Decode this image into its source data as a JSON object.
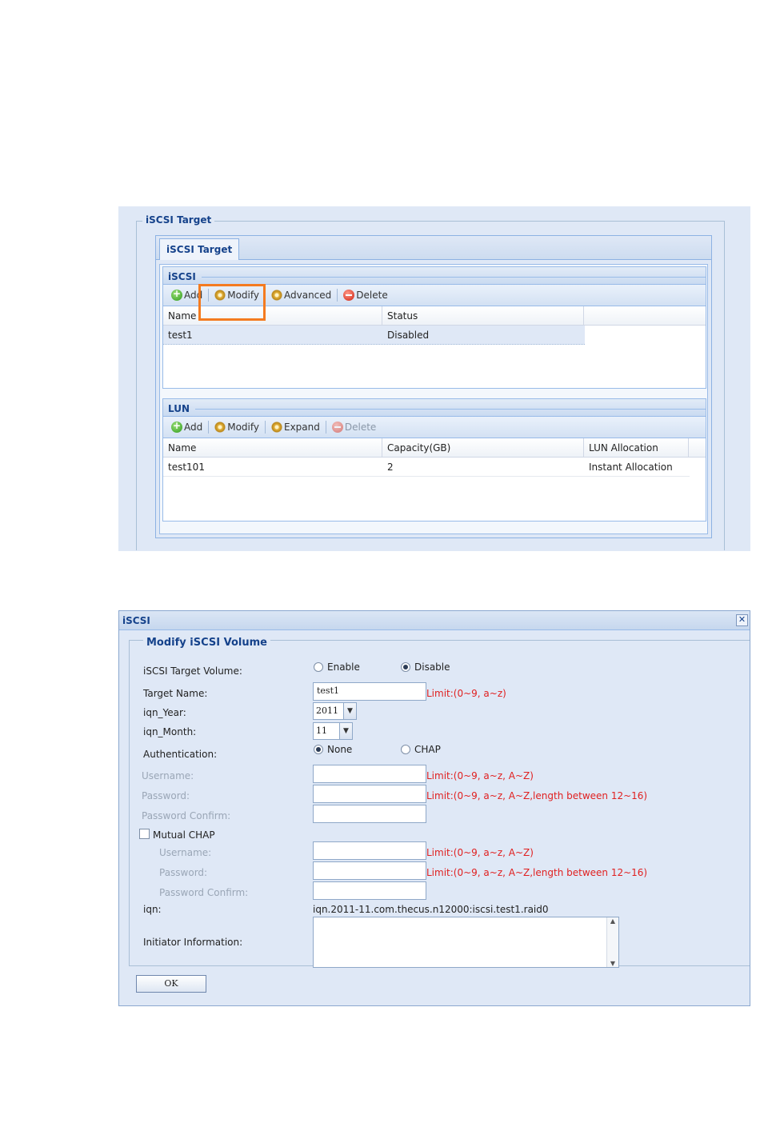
{
  "target_panel": {
    "fieldset_legend": "iSCSI Target",
    "tab_label": "iSCSI Target",
    "iscsi_section": {
      "title": "iSCSI",
      "toolbar": {
        "add": "Add",
        "modify": "Modify",
        "advanced": "Advanced",
        "delete": "Delete"
      },
      "columns": [
        "Name",
        "Status"
      ],
      "rows": [
        {
          "name": "test1",
          "status": "Disabled"
        }
      ]
    },
    "lun_section": {
      "title": "LUN",
      "toolbar": {
        "add": "Add",
        "modify": "Modify",
        "expand": "Expand",
        "delete": "Delete"
      },
      "columns": [
        "Name",
        "Capacity(GB)",
        "LUN Allocation"
      ],
      "rows": [
        {
          "name": "test101",
          "capacity": "2",
          "allocation": "Instant Allocation"
        }
      ]
    }
  },
  "dialog": {
    "title": "iSCSI",
    "legend": "Modify iSCSI Volume",
    "target_volume": {
      "label": "iSCSI Target Volume:",
      "enable": "Enable",
      "disable": "Disable",
      "selected": "Disable"
    },
    "target_name": {
      "label": "Target Name:",
      "value": "test1",
      "limit": "Limit:(0~9, a~z)"
    },
    "iqn_year": {
      "label": "iqn_Year:",
      "value": "2011"
    },
    "iqn_month": {
      "label": "iqn_Month:",
      "value": "11"
    },
    "authentication": {
      "label": "Authentication:",
      "none": "None",
      "chap": "CHAP",
      "selected": "None"
    },
    "username": {
      "label": "Username:",
      "limit": "Limit:(0~9, a~z, A~Z)"
    },
    "password": {
      "label": "Password:",
      "limit": "Limit:(0~9, a~z, A~Z,length between 12~16)"
    },
    "password_confirm": {
      "label": "Password Confirm:"
    },
    "mutual_chap": {
      "label": "Mutual CHAP",
      "checked": false,
      "username": {
        "label": "Username:",
        "limit": "Limit:(0~9, a~z, A~Z)"
      },
      "password": {
        "label": "Password:",
        "limit": "Limit:(0~9, a~z, A~Z,length between 12~16)"
      },
      "password_confirm": {
        "label": "Password Confirm:"
      }
    },
    "iqn": {
      "label": "iqn:",
      "value": "iqn.2011-11.com.thecus.n12000:iscsi.test1.raid0"
    },
    "initiator": {
      "label": "Initiator Information:"
    },
    "ok_label": "OK"
  },
  "colors": {
    "highlight": "#f47b20",
    "limit_text": "#e02020",
    "panel_bg": "#dfe8f6",
    "header_text": "#15428b"
  }
}
